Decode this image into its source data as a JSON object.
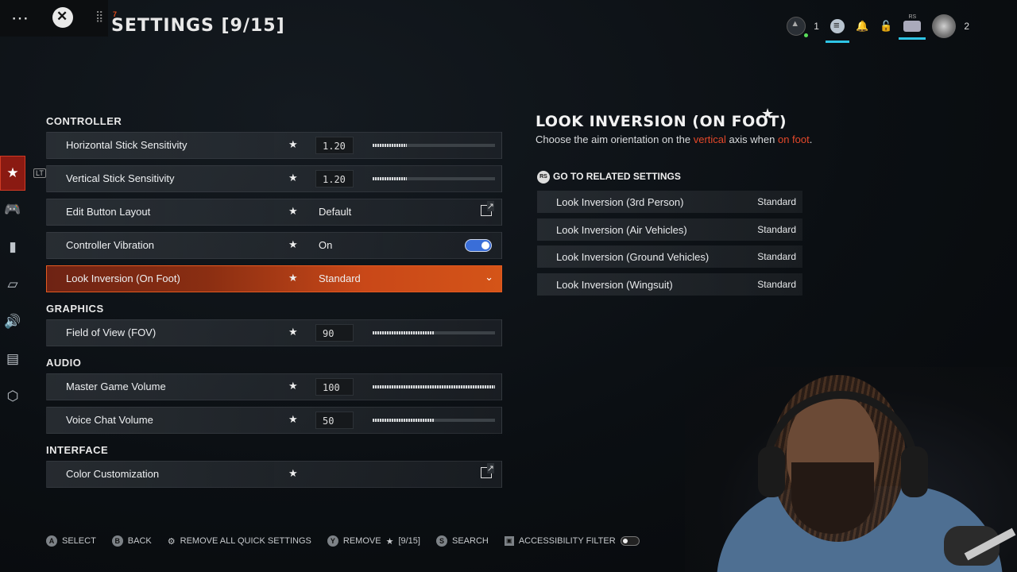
{
  "header": {
    "title": "SETTINGS [9/15]",
    "title_mark": "7"
  },
  "status": {
    "party_count": "1",
    "player_count": "2"
  },
  "sidebar": {
    "lt_label": "LT",
    "items": [
      {
        "icon": "star-icon",
        "glyph": "★",
        "active": true
      },
      {
        "icon": "controller-icon",
        "glyph": "🎮"
      },
      {
        "icon": "mouse-icon",
        "glyph": "▮"
      },
      {
        "icon": "display-icon",
        "glyph": "▱"
      },
      {
        "icon": "speaker-icon",
        "glyph": "🔊"
      },
      {
        "icon": "interface-icon",
        "glyph": "▤"
      },
      {
        "icon": "account-icon",
        "glyph": "⬡"
      }
    ]
  },
  "sections": {
    "controller": {
      "title": "CONTROLLER",
      "rows": [
        {
          "label": "Horizontal Stick Sensitivity",
          "value": "1.20",
          "fill": 0.28
        },
        {
          "label": "Vertical Stick Sensitivity",
          "value": "1.20",
          "fill": 0.28
        },
        {
          "label": "Edit Button Layout",
          "value": "Default"
        },
        {
          "label": "Controller Vibration",
          "value": "On",
          "toggle_on": true
        },
        {
          "label": "Look Inversion (On Foot)",
          "value": "Standard",
          "selected": true
        }
      ]
    },
    "graphics": {
      "title": "GRAPHICS",
      "rows": [
        {
          "label": "Field of View (FOV)",
          "value": "90",
          "fill": 0.5
        }
      ]
    },
    "audio": {
      "title": "AUDIO",
      "rows": [
        {
          "label": "Master Game Volume",
          "value": "100",
          "fill": 1.0
        },
        {
          "label": "Voice Chat Volume",
          "value": "50",
          "fill": 0.5
        }
      ]
    },
    "interface": {
      "title": "INTERFACE",
      "rows": [
        {
          "label": "Color Customization"
        }
      ]
    }
  },
  "detail": {
    "title": "LOOK INVERSION (ON FOOT)",
    "desc_1": "Choose the aim orientation on the ",
    "desc_hl1": "vertical",
    "desc_2": " axis when ",
    "desc_hl2": "on foot",
    "desc_3": ".",
    "related_label": "GO TO RELATED SETTINGS",
    "rs_label": "RS",
    "related": [
      {
        "label": "Look Inversion (3rd Person)",
        "value": "Standard"
      },
      {
        "label": "Look Inversion (Air Vehicles)",
        "value": "Standard"
      },
      {
        "label": "Look Inversion (Ground Vehicles)",
        "value": "Standard"
      },
      {
        "label": "Look Inversion (Wingsuit)",
        "value": "Standard"
      }
    ]
  },
  "footer": {
    "select": {
      "btn": "A",
      "label": "SELECT"
    },
    "back": {
      "btn": "B",
      "label": "BACK"
    },
    "remove_all": {
      "label": "REMOVE ALL QUICK SETTINGS"
    },
    "remove": {
      "btn": "Y",
      "label": "REMOVE",
      "count": "[9/15]"
    },
    "search": {
      "btn": "S",
      "label": "SEARCH"
    },
    "accessibility": {
      "label": "ACCESSIBILITY FILTER"
    }
  },
  "colors": {
    "accent": "#e24a1b",
    "selected_row": "#c94818",
    "toggle_on": "#3a6ed8",
    "highlight_text": "#e4482a"
  }
}
